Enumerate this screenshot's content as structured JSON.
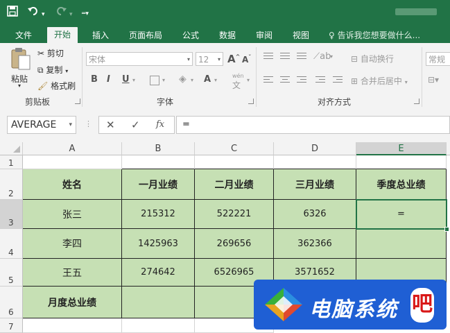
{
  "qat": {
    "save_icon": "save-icon",
    "undo_icon": "undo-icon",
    "redo_icon": "redo-icon",
    "customize_icon": "customize-icon"
  },
  "tabs": [
    {
      "label": "文件"
    },
    {
      "label": "开始"
    },
    {
      "label": "插入"
    },
    {
      "label": "页面布局"
    },
    {
      "label": "公式"
    },
    {
      "label": "数据"
    },
    {
      "label": "审阅"
    },
    {
      "label": "视图"
    }
  ],
  "tell_me": "告诉我您想要做什么...",
  "ribbon": {
    "clipboard": {
      "paste": "粘贴",
      "cut": "剪切",
      "copy": "复制",
      "format_painter": "格式刷",
      "group": "剪贴板"
    },
    "font": {
      "name": "宋体",
      "size": "12",
      "group": "字体",
      "bold": "B",
      "italic": "I",
      "underline": "U",
      "font_color": "A",
      "phonetic": "wén"
    },
    "alignment": {
      "wrap": "自动换行",
      "merge": "合并后居中",
      "group": "对齐方式"
    },
    "number": {
      "format": "常规"
    }
  },
  "formula_bar": {
    "name_box": "AVERAGE",
    "fx": "fx",
    "content": "="
  },
  "grid": {
    "columns": [
      "A",
      "B",
      "C",
      "D",
      "E"
    ],
    "rows": [
      "1",
      "2",
      "3",
      "4",
      "5",
      "6",
      "7"
    ],
    "header": [
      "姓名",
      "一月业绩",
      "二月业绩",
      "三月业绩",
      "季度总业绩"
    ],
    "data": [
      [
        "张三",
        "215312",
        "522221",
        "6326",
        "="
      ],
      [
        "李四",
        "1425963",
        "269656",
        "362366",
        ""
      ],
      [
        "王五",
        "274642",
        "6526965",
        "3571652",
        ""
      ]
    ],
    "total_label": "月度总业绩"
  },
  "colors": {
    "accent": "#217346",
    "cell_fill": "#c6e0b4",
    "watermark_bg": "#1f5fd4"
  }
}
